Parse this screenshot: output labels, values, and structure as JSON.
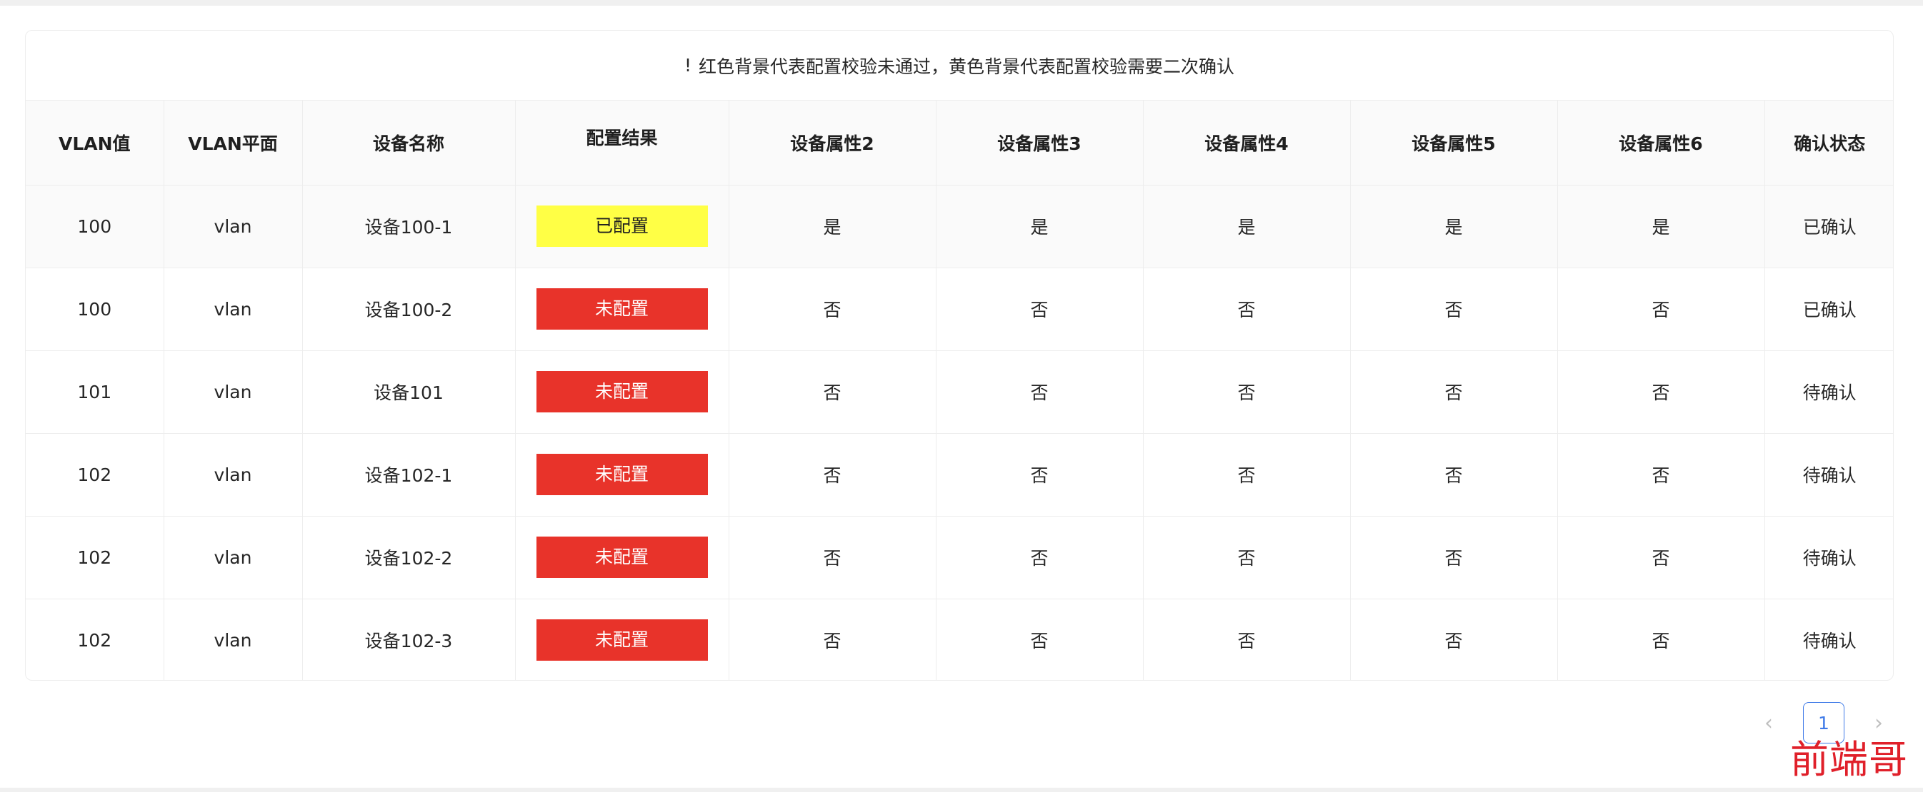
{
  "notice": {
    "icon": "!",
    "text": "红色背景代表配置校验未通过，黄色背景代表配置校验需要二次确认"
  },
  "table": {
    "columns": [
      "VLAN值",
      "VLAN平面",
      "设备名称",
      "配置结果",
      "设备属性2",
      "设备属性3",
      "设备属性4",
      "设备属性5",
      "设备属性6",
      "确认状态"
    ],
    "rows": [
      {
        "vlan": "100",
        "plane": "vlan",
        "device": "设备100-1",
        "result": "已配置",
        "result_color": "yellow",
        "attr2": "是",
        "attr3": "是",
        "attr4": "是",
        "attr5": "是",
        "attr6": "是",
        "status": "已确认"
      },
      {
        "vlan": "100",
        "plane": "vlan",
        "device": "设备100-2",
        "result": "未配置",
        "result_color": "red",
        "attr2": "否",
        "attr3": "否",
        "attr4": "否",
        "attr5": "否",
        "attr6": "否",
        "status": "已确认"
      },
      {
        "vlan": "101",
        "plane": "vlan",
        "device": "设备101",
        "result": "未配置",
        "result_color": "red",
        "attr2": "否",
        "attr3": "否",
        "attr4": "否",
        "attr5": "否",
        "attr6": "否",
        "status": "待确认"
      },
      {
        "vlan": "102",
        "plane": "vlan",
        "device": "设备102-1",
        "result": "未配置",
        "result_color": "red",
        "attr2": "否",
        "attr3": "否",
        "attr4": "否",
        "attr5": "否",
        "attr6": "否",
        "status": "待确认"
      },
      {
        "vlan": "102",
        "plane": "vlan",
        "device": "设备102-2",
        "result": "未配置",
        "result_color": "red",
        "attr2": "否",
        "attr3": "否",
        "attr4": "否",
        "attr5": "否",
        "attr6": "否",
        "status": "待确认"
      },
      {
        "vlan": "102",
        "plane": "vlan",
        "device": "设备102-3",
        "result": "未配置",
        "result_color": "red",
        "attr2": "否",
        "attr3": "否",
        "attr4": "否",
        "attr5": "否",
        "attr6": "否",
        "status": "待确认"
      }
    ]
  },
  "pagination": {
    "prev_icon": "‹",
    "current_page": "1",
    "next_icon": "›"
  },
  "watermark": {
    "text": "前端哥"
  },
  "colors": {
    "yellow_tag": "#ffff45",
    "red_tag": "#e8332a",
    "accent": "#3f7ae8",
    "watermark": "#e0202a"
  }
}
